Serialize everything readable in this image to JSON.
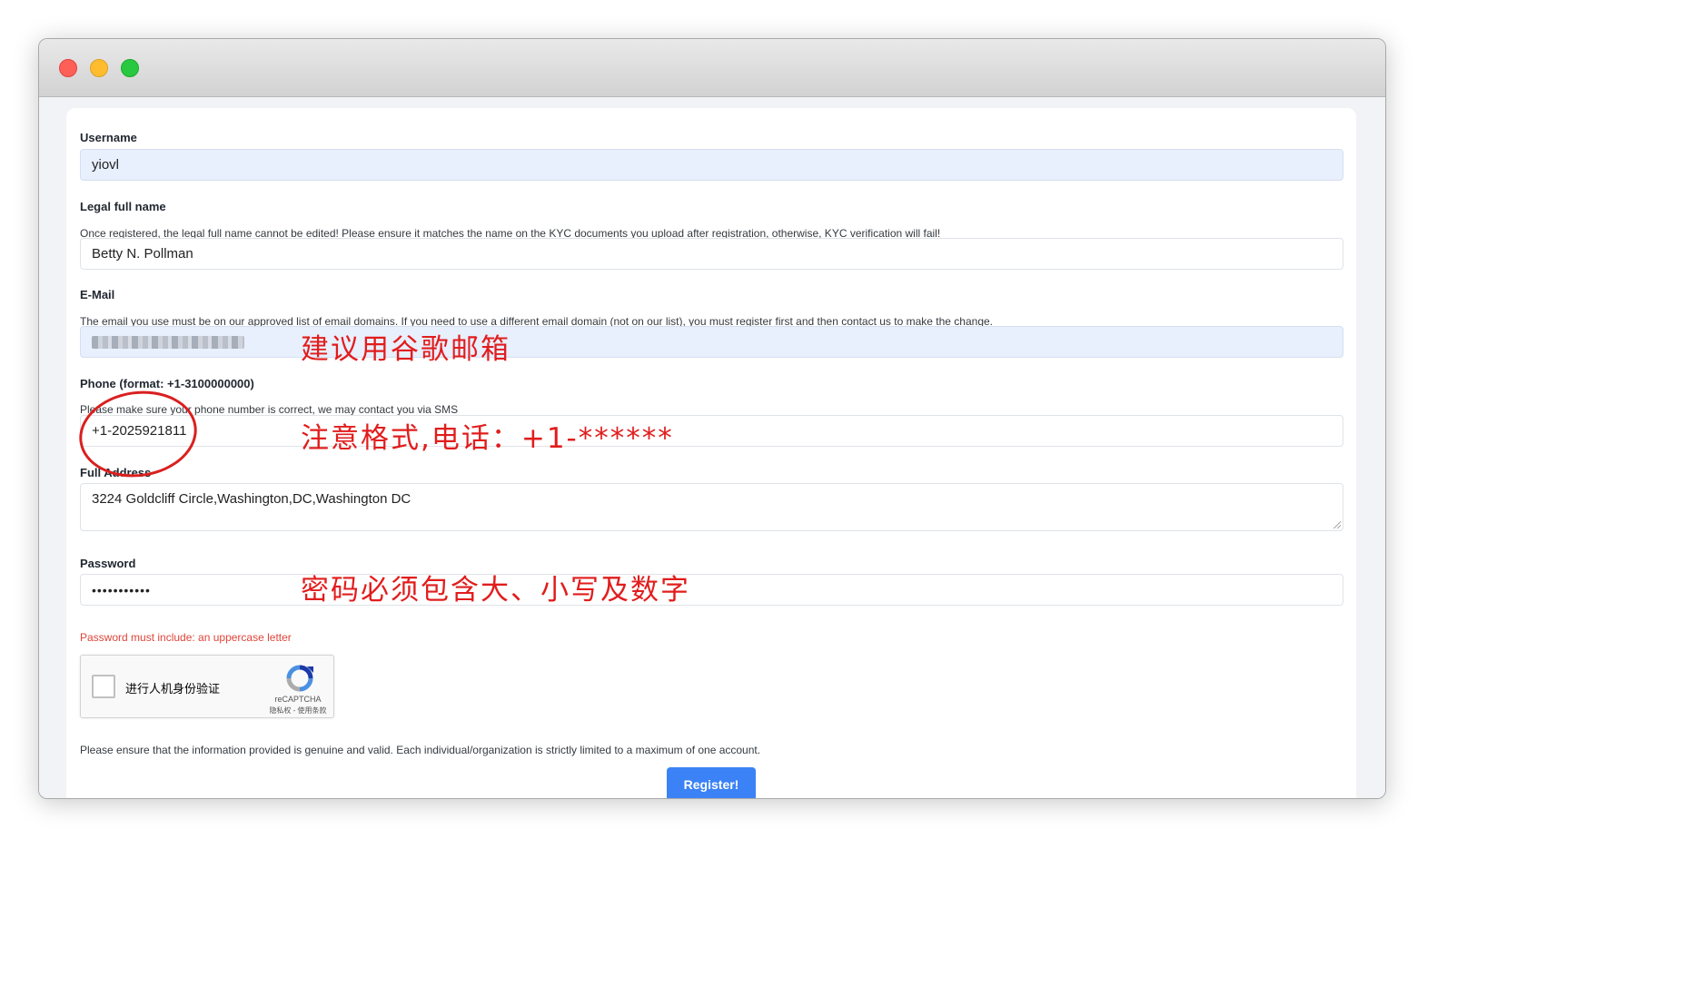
{
  "form": {
    "username": {
      "label": "Username",
      "value": "yiovl"
    },
    "legal_name": {
      "label": "Legal full name",
      "help": "Once registered, the legal full name cannot be edited! Please ensure it matches the name on the KYC documents you upload after registration, otherwise, KYC verification will fail!",
      "value": "Betty N. Pollman"
    },
    "email": {
      "label": "E-Mail",
      "help_before": "The email you use must be on our approved ",
      "help_link": "list of email domains",
      "help_after": ". If you need to use a different email domain (not on our list), you must register first and then contact us to make the change."
    },
    "phone": {
      "label": "Phone (format: +1-3100000000)",
      "help": "Please make sure your phone number is correct, we may contact you via SMS",
      "value": "+1-2025921811"
    },
    "address": {
      "label": "Full Address",
      "value": "3224 Goldcliff Circle,Washington,DC,Washington DC"
    },
    "password": {
      "label": "Password",
      "value": "•••••••••••",
      "error": "Password must include: an uppercase letter"
    },
    "captcha": {
      "text": "进行人机身份验证",
      "brand": "reCAPTCHA",
      "terms": "隐私权 - 使用条款"
    },
    "notice": "Please ensure that the information provided is genuine and valid. Each individual/organization is strictly limited to a maximum of one account.",
    "register_label": "Register!"
  },
  "annotations": {
    "email_note": "建议用谷歌邮箱",
    "phone_note": "注意格式,电话：+1-******",
    "password_note": "密码必须包含大、小写及数字"
  },
  "colors": {
    "accent": "#3b82f6",
    "annotation": "#e11d1d",
    "error": "#e0453a"
  },
  "icons": {
    "captcha_logo": "recaptcha-logo-icon"
  }
}
